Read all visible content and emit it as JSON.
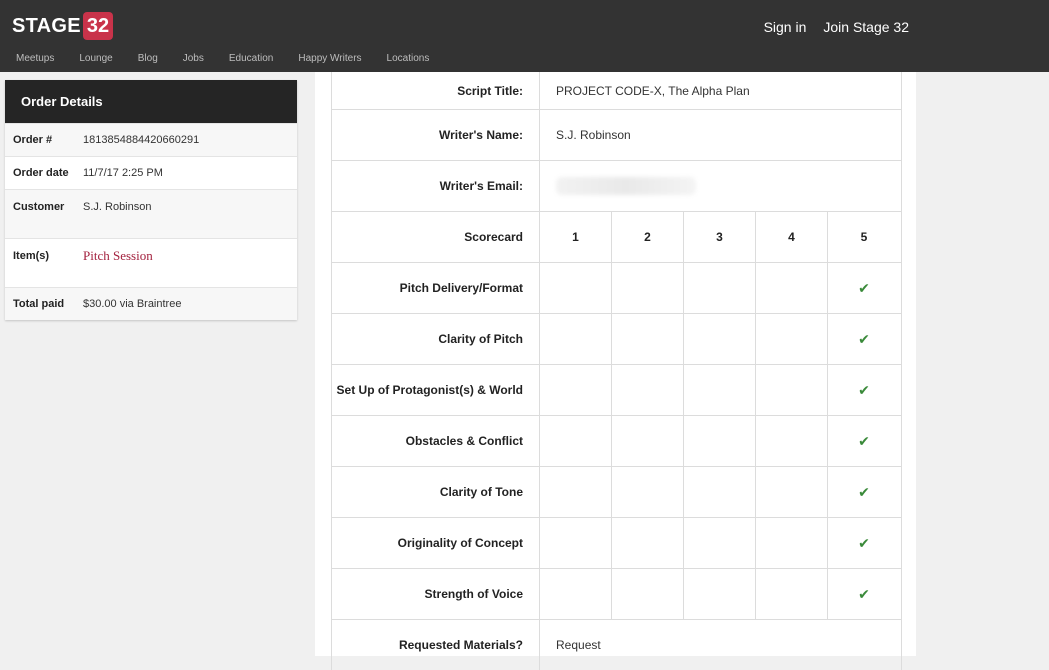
{
  "header": {
    "logo_text": "STAGE",
    "logo_number": "32",
    "sign_in": "Sign in",
    "join": "Join Stage 32",
    "nav": [
      "Meetups",
      "Lounge",
      "Blog",
      "Jobs",
      "Education",
      "Happy Writers",
      "Locations"
    ]
  },
  "order": {
    "title": "Order Details",
    "rows": [
      {
        "label": "Order #",
        "value": "1813854884420660291"
      },
      {
        "label": "Order date",
        "value": "11/7/17 2:25 PM"
      },
      {
        "label": "Customer",
        "value": "S.J. Robinson"
      },
      {
        "label": "Item(s)",
        "value": "Pitch Session"
      },
      {
        "label": "Total paid",
        "value": "$30.00 via Braintree"
      }
    ]
  },
  "details": {
    "script_title_label": "Script Title:",
    "script_title": "PROJECT CODE-X, The Alpha Plan",
    "writer_name_label": "Writer's Name:",
    "writer_name": "S.J. Robinson",
    "writer_email_label": "Writer's Email:",
    "scorecard_label": "Scorecard",
    "score_columns": [
      "1",
      "2",
      "3",
      "4",
      "5"
    ],
    "criteria": [
      {
        "label": "Pitch Delivery/Format",
        "score": 5
      },
      {
        "label": "Clarity of Pitch",
        "score": 5
      },
      {
        "label": "Set Up of Protagonist(s) & World",
        "score": 5
      },
      {
        "label": "Obstacles & Conflict",
        "score": 5
      },
      {
        "label": "Clarity of Tone",
        "score": 5
      },
      {
        "label": "Originality of Concept",
        "score": 5
      },
      {
        "label": "Strength of Voice",
        "score": 5
      }
    ],
    "requested_label": "Requested Materials?",
    "requested_value": "Request"
  },
  "colors": {
    "header_bg": "#333333",
    "logo_red": "#c9334a",
    "check_green": "#3a8a3a",
    "item_link": "#a3213e"
  },
  "icons": {
    "check": "checkmark-icon"
  }
}
